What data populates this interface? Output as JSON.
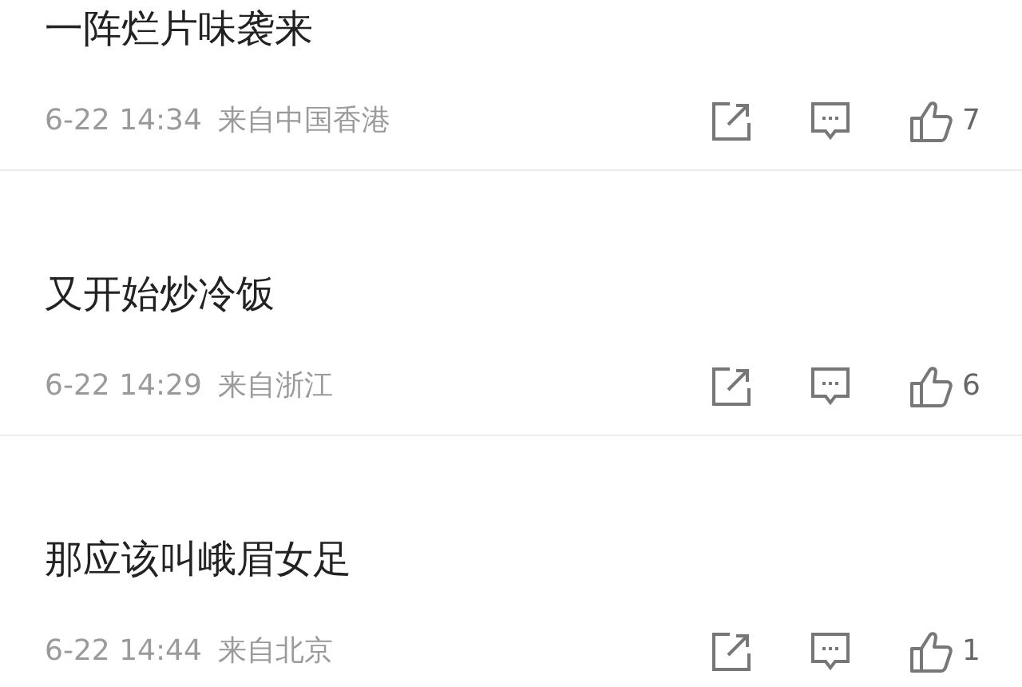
{
  "comments": [
    {
      "text": "一阵烂片味袭来",
      "time": "6-22 14:34",
      "source": "来自中国香港",
      "likes": "7"
    },
    {
      "text": "又开始炒冷饭",
      "time": "6-22 14:29",
      "source": "来自浙江",
      "likes": "6"
    },
    {
      "text": "那应该叫峨眉女足",
      "time": "6-22 14:44",
      "source": "来自北京",
      "likes": "1"
    }
  ]
}
